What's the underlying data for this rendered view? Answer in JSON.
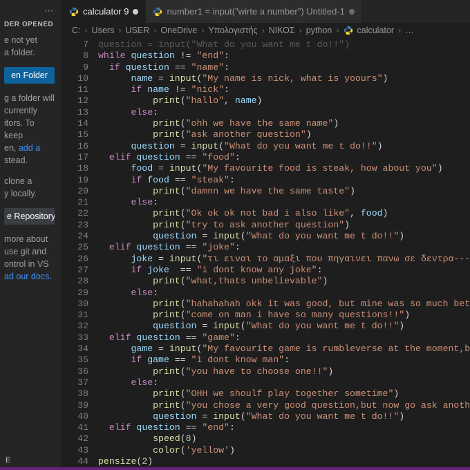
{
  "sidebar": {
    "dots": "⋯",
    "header": "DER OPENED",
    "p1a": "e not yet",
    "p1b": "a folder.",
    "open_btn": "en Folder",
    "p2a": "g a folder will",
    "p2b": "currently",
    "p2c": "itors. To keep",
    "p2d": "en, ",
    "p2d_link": "add a",
    "p2e": "stead.",
    "p3a": "clone a",
    "p3b": "y locally.",
    "clone_btn": "e Repository",
    "p4a": "more about",
    "p4b": "use git and",
    "p4c": "ontrol in VS",
    "p4d": "ad our docs",
    "p4dot": ".",
    "bottom": "E"
  },
  "tabs": [
    {
      "icon": "python",
      "label": "calculator 9",
      "dirty": true,
      "active": true
    },
    {
      "icon": "python",
      "label": "number1 = input(\"wirte a number\")  Untitled-1",
      "dirty": true,
      "active": false
    }
  ],
  "breadcrumb": {
    "parts": [
      "C:",
      "Users",
      "USER",
      "OneDrive",
      "Υπολογιστής",
      "ΝΙΚΟΣ",
      "python"
    ],
    "file_icon": "python",
    "file": "calculator",
    "trail": "…"
  },
  "code": {
    "first_line": 7,
    "lines": [
      {
        "t": [
          [
            "dim",
            "question = input(\"What do you want me t do!!\")"
          ]
        ]
      },
      {
        "t": [
          [
            "k",
            "while"
          ],
          [
            "p",
            " "
          ],
          [
            "v",
            "question"
          ],
          [
            "p",
            " != "
          ],
          [
            "s",
            "\"end\""
          ],
          [
            "p",
            ":"
          ]
        ]
      },
      {
        "t": [
          [
            "p",
            "  "
          ],
          [
            "k",
            "if"
          ],
          [
            "p",
            " "
          ],
          [
            "v",
            "question"
          ],
          [
            "p",
            " == "
          ],
          [
            "s",
            "\"name\""
          ],
          [
            "p",
            ":"
          ]
        ]
      },
      {
        "t": [
          [
            "p",
            "      "
          ],
          [
            "v",
            "name"
          ],
          [
            "p",
            " = "
          ],
          [
            "f",
            "input"
          ],
          [
            "p",
            "("
          ],
          [
            "s",
            "\"My name is nick, what is yoours\""
          ],
          [
            "p",
            ")"
          ]
        ]
      },
      {
        "t": [
          [
            "p",
            "      "
          ],
          [
            "k",
            "if"
          ],
          [
            "p",
            " "
          ],
          [
            "v",
            "name"
          ],
          [
            "p",
            " != "
          ],
          [
            "s",
            "\"nick\""
          ],
          [
            "p",
            ":"
          ]
        ]
      },
      {
        "t": [
          [
            "p",
            "          "
          ],
          [
            "f",
            "print"
          ],
          [
            "p",
            "("
          ],
          [
            "s",
            "\"hallo\""
          ],
          [
            "p",
            ", "
          ],
          [
            "v",
            "name"
          ],
          [
            "p",
            ")"
          ]
        ]
      },
      {
        "t": [
          [
            "p",
            "      "
          ],
          [
            "k",
            "else"
          ],
          [
            "p",
            ":"
          ]
        ]
      },
      {
        "t": [
          [
            "p",
            "          "
          ],
          [
            "f",
            "print"
          ],
          [
            "p",
            "("
          ],
          [
            "s",
            "\"ohh we have the same name\""
          ],
          [
            "p",
            ")"
          ]
        ]
      },
      {
        "t": [
          [
            "p",
            "          "
          ],
          [
            "f",
            "print"
          ],
          [
            "p",
            "("
          ],
          [
            "s",
            "\"ask another question\""
          ],
          [
            "p",
            ")"
          ]
        ]
      },
      {
        "t": [
          [
            "p",
            "      "
          ],
          [
            "v",
            "question"
          ],
          [
            "p",
            " = "
          ],
          [
            "f",
            "input"
          ],
          [
            "p",
            "("
          ],
          [
            "s",
            "\"What do you want me t do!!\""
          ],
          [
            "p",
            ")"
          ]
        ]
      },
      {
        "t": [
          [
            "p",
            "  "
          ],
          [
            "k",
            "elif"
          ],
          [
            "p",
            " "
          ],
          [
            "v",
            "question"
          ],
          [
            "p",
            " == "
          ],
          [
            "s",
            "\"food\""
          ],
          [
            "p",
            ":"
          ]
        ]
      },
      {
        "t": [
          [
            "p",
            "      "
          ],
          [
            "v",
            "food"
          ],
          [
            "p",
            " = "
          ],
          [
            "f",
            "input"
          ],
          [
            "p",
            "("
          ],
          [
            "s",
            "\"My favourite food is steak, how about you\""
          ],
          [
            "p",
            ")"
          ]
        ]
      },
      {
        "t": [
          [
            "p",
            "      "
          ],
          [
            "k",
            "if"
          ],
          [
            "p",
            " "
          ],
          [
            "v",
            "food"
          ],
          [
            "p",
            " == "
          ],
          [
            "s",
            "\"steak\""
          ],
          [
            "p",
            ":"
          ]
        ]
      },
      {
        "t": [
          [
            "p",
            "          "
          ],
          [
            "f",
            "print"
          ],
          [
            "p",
            "("
          ],
          [
            "s",
            "\"damnn we have the same taste\""
          ],
          [
            "p",
            ")"
          ]
        ]
      },
      {
        "t": [
          [
            "p",
            "      "
          ],
          [
            "k",
            "else"
          ],
          [
            "p",
            ":"
          ]
        ]
      },
      {
        "t": [
          [
            "p",
            "          "
          ],
          [
            "f",
            "print"
          ],
          [
            "p",
            "("
          ],
          [
            "s",
            "\"Ok ok ok not bad i also like\""
          ],
          [
            "p",
            ", "
          ],
          [
            "v",
            "food"
          ],
          [
            "p",
            ")"
          ]
        ]
      },
      {
        "t": [
          [
            "p",
            "          "
          ],
          [
            "f",
            "print"
          ],
          [
            "p",
            "("
          ],
          [
            "s",
            "\"try to ask another question\""
          ],
          [
            "p",
            ")"
          ]
        ]
      },
      {
        "t": [
          [
            "p",
            "          "
          ],
          [
            "v",
            "question"
          ],
          [
            "p",
            " = "
          ],
          [
            "f",
            "input"
          ],
          [
            "p",
            "("
          ],
          [
            "s",
            "\"What do you want me t do!!\""
          ],
          [
            "p",
            ")"
          ]
        ]
      },
      {
        "t": [
          [
            "p",
            "  "
          ],
          [
            "k",
            "elif"
          ],
          [
            "p",
            " "
          ],
          [
            "v",
            "question"
          ],
          [
            "p",
            " == "
          ],
          [
            "s",
            "\"joke\""
          ],
          [
            "p",
            ":"
          ]
        ]
      },
      {
        "t": [
          [
            "p",
            "      "
          ],
          [
            "v",
            "joke"
          ],
          [
            "p",
            " = "
          ],
          [
            "f",
            "input"
          ],
          [
            "p",
            "("
          ],
          [
            "s",
            "\"τι ειναι το αμαξι που πηγαινει πανω σε δεντρα-----χιμπατ"
          ],
          [
            "p",
            "…"
          ]
        ]
      },
      {
        "t": [
          [
            "p",
            "      "
          ],
          [
            "k",
            "if"
          ],
          [
            "p",
            " "
          ],
          [
            "v",
            "joke"
          ],
          [
            "p",
            "  == "
          ],
          [
            "s",
            "\"i dont know any joke\""
          ],
          [
            "p",
            ":"
          ]
        ]
      },
      {
        "t": [
          [
            "p",
            "          "
          ],
          [
            "f",
            "print"
          ],
          [
            "p",
            "("
          ],
          [
            "s",
            "\"what,thats unbelievable\""
          ],
          [
            "p",
            ")"
          ]
        ]
      },
      {
        "t": [
          [
            "p",
            "      "
          ],
          [
            "k",
            "else"
          ],
          [
            "p",
            ":"
          ]
        ]
      },
      {
        "t": [
          [
            "p",
            "          "
          ],
          [
            "f",
            "print"
          ],
          [
            "p",
            "("
          ],
          [
            "s",
            "\"hahahahah okk it was good, but mine was so much better\""
          ],
          [
            "p",
            ")"
          ]
        ]
      },
      {
        "t": [
          [
            "p",
            "          "
          ],
          [
            "f",
            "print"
          ],
          [
            "p",
            "("
          ],
          [
            "s",
            "\"come on man i have so many questions!!\""
          ],
          [
            "p",
            ")"
          ]
        ]
      },
      {
        "t": [
          [
            "p",
            "          "
          ],
          [
            "v",
            "question"
          ],
          [
            "p",
            " = "
          ],
          [
            "f",
            "input"
          ],
          [
            "p",
            "("
          ],
          [
            "s",
            "\"What do you want me t do!!\""
          ],
          [
            "p",
            ")"
          ]
        ]
      },
      {
        "t": [
          [
            "p",
            "  "
          ],
          [
            "k",
            "elif"
          ],
          [
            "p",
            " "
          ],
          [
            "v",
            "question"
          ],
          [
            "p",
            " == "
          ],
          [
            "s",
            "\"game\""
          ],
          [
            "p",
            ":"
          ]
        ]
      },
      {
        "t": [
          [
            "p",
            "      "
          ],
          [
            "v",
            "game"
          ],
          [
            "p",
            " = "
          ],
          [
            "f",
            "input"
          ],
          [
            "p",
            "("
          ],
          [
            "s",
            "\"My favourite game is rumbleverse at the moment,but the re"
          ]
        ]
      },
      {
        "t": [
          [
            "p",
            "      "
          ],
          [
            "k",
            "if"
          ],
          [
            "p",
            " "
          ],
          [
            "v",
            "game"
          ],
          [
            "p",
            " == "
          ],
          [
            "s",
            "\"i dont know man\""
          ],
          [
            "p",
            ":"
          ]
        ]
      },
      {
        "t": [
          [
            "p",
            "          "
          ],
          [
            "f",
            "print"
          ],
          [
            "p",
            "("
          ],
          [
            "s",
            "\"you have to choose one!!\""
          ],
          [
            "p",
            ")"
          ]
        ]
      },
      {
        "t": [
          [
            "p",
            "      "
          ],
          [
            "k",
            "else"
          ],
          [
            "p",
            ":"
          ]
        ]
      },
      {
        "t": [
          [
            "p",
            "          "
          ],
          [
            "f",
            "print"
          ],
          [
            "p",
            "("
          ],
          [
            "s",
            "\"OHH we shoulf play together sometime\""
          ],
          [
            "p",
            ")"
          ]
        ]
      },
      {
        "t": [
          [
            "p",
            "          "
          ],
          [
            "f",
            "print"
          ],
          [
            "p",
            "("
          ],
          [
            "s",
            "\"you chose a very good question,but now go ask another one\""
          ],
          [
            "p",
            ")"
          ]
        ]
      },
      {
        "t": [
          [
            "p",
            "          "
          ],
          [
            "v",
            "question"
          ],
          [
            "p",
            " = "
          ],
          [
            "f",
            "input"
          ],
          [
            "p",
            "("
          ],
          [
            "s",
            "\"What do you want me t do!!\""
          ],
          [
            "p",
            ")"
          ]
        ]
      },
      {
        "t": [
          [
            "p",
            "  "
          ],
          [
            "k",
            "elif"
          ],
          [
            "p",
            " "
          ],
          [
            "v",
            "question"
          ],
          [
            "p",
            " == "
          ],
          [
            "s",
            "\"end\""
          ],
          [
            "p",
            ":"
          ]
        ]
      },
      {
        "t": [
          [
            "p",
            "          "
          ],
          [
            "f",
            "speed"
          ],
          [
            "p",
            "("
          ],
          [
            "n",
            "8"
          ],
          [
            "p",
            ")"
          ]
        ]
      },
      {
        "t": [
          [
            "p",
            "          "
          ],
          [
            "f",
            "color"
          ],
          [
            "p",
            "("
          ],
          [
            "s",
            "'yellow'"
          ],
          [
            "p",
            ")"
          ]
        ]
      },
      {
        "t": [
          [
            "f",
            "pensize"
          ],
          [
            "p",
            "("
          ],
          [
            "n",
            "2"
          ],
          [
            "p",
            ")"
          ]
        ]
      }
    ]
  }
}
